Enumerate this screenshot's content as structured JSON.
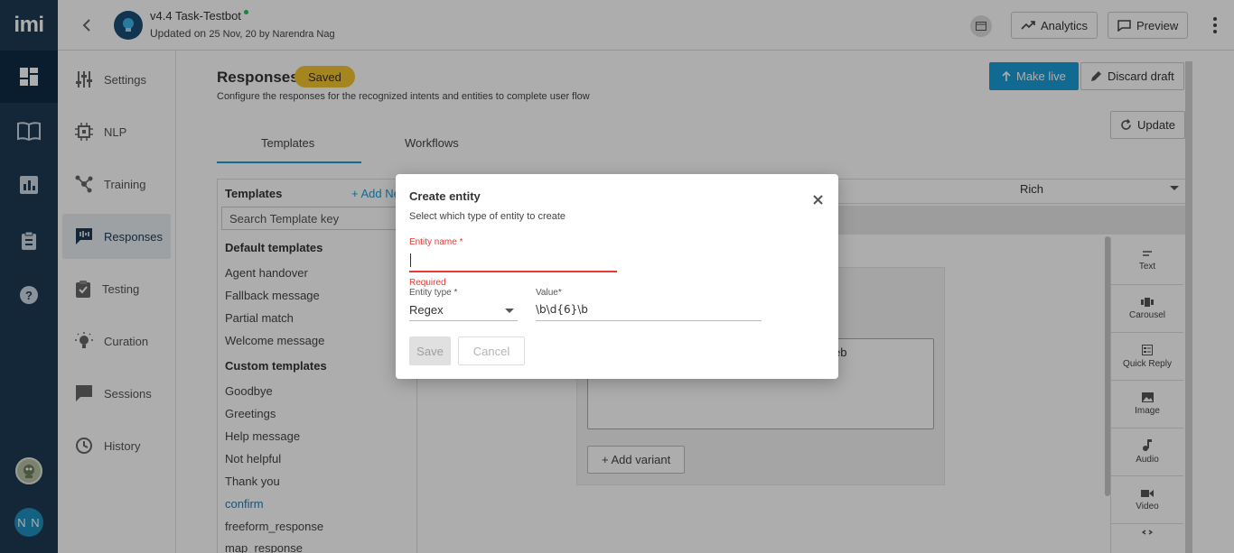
{
  "rail": {
    "logo": "imi",
    "items": [
      {
        "icon": "dashboard-icon"
      },
      {
        "icon": "book-icon"
      },
      {
        "icon": "bar-chart-icon"
      },
      {
        "icon": "clipboard-icon"
      },
      {
        "icon": "help-icon"
      }
    ],
    "user_initials": "N N"
  },
  "header": {
    "bot_name": "v4.4 Task-Testbot",
    "updated_prefix": "Updated on ",
    "updated_date": "25 Nov, 20",
    "updated_by": " by Narendra Nag",
    "analytics_label": "Analytics",
    "preview_label": "Preview"
  },
  "subnav": {
    "items": [
      {
        "label": "Settings",
        "icon": "sliders-icon"
      },
      {
        "label": "NLP",
        "icon": "chip-icon"
      },
      {
        "label": "Training",
        "icon": "nodes-icon"
      },
      {
        "label": "Responses",
        "icon": "chat-icon"
      },
      {
        "label": "Testing",
        "icon": "checklist-icon"
      },
      {
        "label": "Curation",
        "icon": "bulb-icon"
      },
      {
        "label": "Sessions",
        "icon": "message-icon"
      },
      {
        "label": "History",
        "icon": "history-icon"
      }
    ]
  },
  "main": {
    "title": "Responses",
    "badge": "Saved",
    "description": "Configure the responses for the recognized intents and entities to complete user flow",
    "make_live": "Make live",
    "discard_draft": "Discard draft",
    "update": "Update",
    "tabs": [
      "Templates",
      "Workflows"
    ],
    "templates_header": "Templates",
    "add_new": "+ Add Ne",
    "search_placeholder": "Search Template key",
    "default_group": "Default templates",
    "default_items": [
      "Agent handover",
      "Fallback message",
      "Partial match",
      "Welcome message"
    ],
    "custom_group": "Custom templates",
    "custom_items": [
      "Goodbye",
      "Greetings",
      "Help message",
      "Not helpful",
      "Thank you",
      "confirm",
      "freeform_response",
      "map_response"
    ],
    "rich_select": "Rich",
    "textarea_fragment": "eb",
    "add_variant": "+ Add variant",
    "palette": [
      "Text",
      "Carousel",
      "Quick Reply",
      "Image",
      "Audio",
      "Video"
    ]
  },
  "modal": {
    "title": "Create entity",
    "subtitle": "Select which type of entity to create",
    "entity_name_label": "Entity name *",
    "error": "Required",
    "entity_type_label": "Entity type *",
    "entity_type_value": "Regex",
    "value_label": "Value*",
    "value": "\\b\\d{6}\\b",
    "save": "Save",
    "cancel": "Cancel"
  }
}
